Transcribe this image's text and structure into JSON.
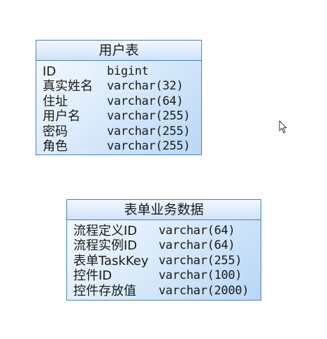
{
  "entities": [
    {
      "title": "用户表",
      "fields": [
        {
          "name": "ID",
          "type": "bigint"
        },
        {
          "name": "真实姓名",
          "type": "varchar(32)"
        },
        {
          "name": "住址",
          "type": "varchar(64)"
        },
        {
          "name": "用户名",
          "type": "varchar(255)"
        },
        {
          "name": "密码",
          "type": "varchar(255)"
        },
        {
          "name": "角色",
          "type": "varchar(255)"
        }
      ]
    },
    {
      "title": "表单业务数据",
      "fields": [
        {
          "name": "流程定义ID",
          "type": "varchar(64)"
        },
        {
          "name": "流程实例ID",
          "type": "varchar(64)"
        },
        {
          "name": "表单TaskKey",
          "type": "varchar(255)"
        },
        {
          "name": "控件ID",
          "type": "varchar(100)"
        },
        {
          "name": "控件存放值",
          "type": "varchar(2000)"
        }
      ]
    }
  ],
  "cursor_icon": "mouse-pointer-icon"
}
